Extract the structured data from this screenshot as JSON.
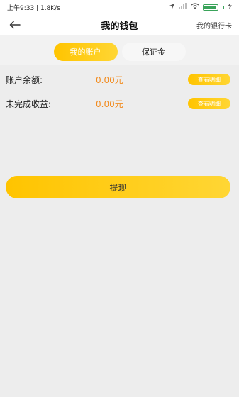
{
  "statusbar": {
    "time_network": "上午9:33 | 1.8K/s",
    "battery": 0.9
  },
  "header": {
    "title": "我的钱包",
    "bank_card_link": "我的银行卡"
  },
  "tabs": [
    {
      "label": "我的账户",
      "active": true
    },
    {
      "label": "保证金",
      "active": false
    }
  ],
  "balances": [
    {
      "label": "账户余额:",
      "value": "0.00元",
      "button": "查看明细"
    },
    {
      "label": "未完成收益:",
      "value": "0.00元",
      "button": "查看明细"
    }
  ],
  "withdraw_label": "提现",
  "colors": {
    "accent": "#ffc400",
    "amount": "#f28b1e",
    "background": "#ededed"
  }
}
